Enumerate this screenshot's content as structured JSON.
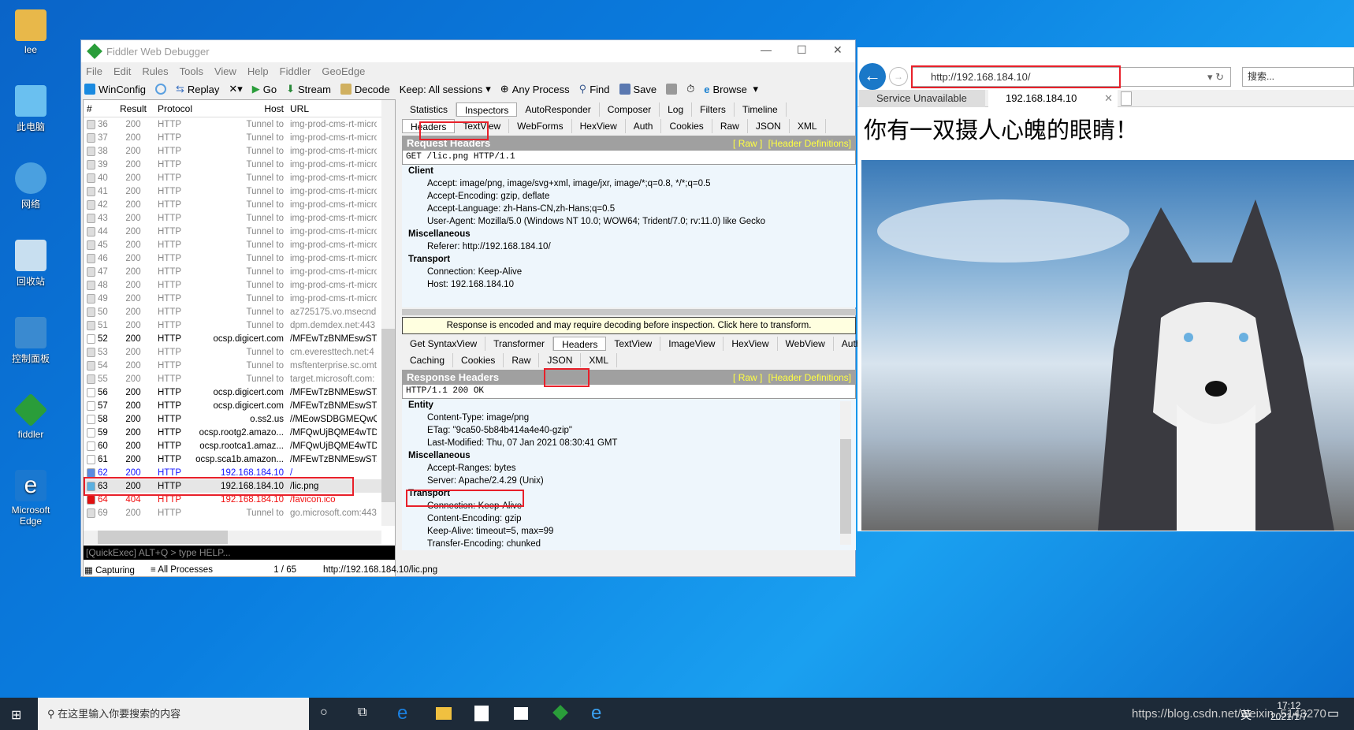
{
  "desktop": {
    "icons": [
      "lee",
      "此电脑",
      "网络",
      "回收站",
      "控制面板",
      "fiddler",
      "Microsoft Edge"
    ]
  },
  "fiddler": {
    "title": "Fiddler Web Debugger",
    "menu": [
      "File",
      "Edit",
      "Rules",
      "Tools",
      "View",
      "Help",
      "Fiddler",
      "GeoEdge"
    ],
    "toolbar": {
      "winconfig": "WinConfig",
      "replay": "Replay",
      "go": "Go",
      "stream": "Stream",
      "decode": "Decode",
      "keep": "Keep: All sessions",
      "process": "Any Process",
      "find": "Find",
      "save": "Save",
      "browse": "Browse"
    },
    "columns": [
      "#",
      "Result",
      "Protocol",
      "Host",
      "URL"
    ],
    "rows": [
      [
        "36",
        "200",
        "HTTP",
        "Tunnel to",
        "img-prod-cms-rt-micro",
        "lock",
        "tunnel"
      ],
      [
        "37",
        "200",
        "HTTP",
        "Tunnel to",
        "img-prod-cms-rt-micro",
        "lock",
        "tunnel"
      ],
      [
        "38",
        "200",
        "HTTP",
        "Tunnel to",
        "img-prod-cms-rt-micro",
        "lock",
        "tunnel"
      ],
      [
        "39",
        "200",
        "HTTP",
        "Tunnel to",
        "img-prod-cms-rt-micro",
        "lock",
        "tunnel"
      ],
      [
        "40",
        "200",
        "HTTP",
        "Tunnel to",
        "img-prod-cms-rt-micro",
        "lock",
        "tunnel"
      ],
      [
        "41",
        "200",
        "HTTP",
        "Tunnel to",
        "img-prod-cms-rt-micro",
        "lock",
        "tunnel"
      ],
      [
        "42",
        "200",
        "HTTP",
        "Tunnel to",
        "img-prod-cms-rt-micro",
        "lock",
        "tunnel"
      ],
      [
        "43",
        "200",
        "HTTP",
        "Tunnel to",
        "img-prod-cms-rt-micro",
        "lock",
        "tunnel"
      ],
      [
        "44",
        "200",
        "HTTP",
        "Tunnel to",
        "img-prod-cms-rt-micro",
        "lock",
        "tunnel"
      ],
      [
        "45",
        "200",
        "HTTP",
        "Tunnel to",
        "img-prod-cms-rt-micro",
        "lock",
        "tunnel"
      ],
      [
        "46",
        "200",
        "HTTP",
        "Tunnel to",
        "img-prod-cms-rt-micro",
        "lock",
        "tunnel"
      ],
      [
        "47",
        "200",
        "HTTP",
        "Tunnel to",
        "img-prod-cms-rt-micro",
        "lock",
        "tunnel"
      ],
      [
        "48",
        "200",
        "HTTP",
        "Tunnel to",
        "img-prod-cms-rt-micro",
        "lock",
        "tunnel"
      ],
      [
        "49",
        "200",
        "HTTP",
        "Tunnel to",
        "img-prod-cms-rt-micro",
        "lock",
        "tunnel"
      ],
      [
        "50",
        "200",
        "HTTP",
        "Tunnel to",
        "az725175.vo.msecnd.",
        "lock",
        "tunnel"
      ],
      [
        "51",
        "200",
        "HTTP",
        "Tunnel to",
        "dpm.demdex.net:443",
        "lock",
        "tunnel"
      ],
      [
        "52",
        "200",
        "HTTP",
        "ocsp.digicert.com",
        "/MFEwTzBNMEswSTAJ",
        "doc",
        "normal"
      ],
      [
        "53",
        "200",
        "HTTP",
        "Tunnel to",
        "cm.everesttech.net:4",
        "lock",
        "tunnel"
      ],
      [
        "54",
        "200",
        "HTTP",
        "Tunnel to",
        "msftenterprise.sc.omt",
        "lock",
        "tunnel"
      ],
      [
        "55",
        "200",
        "HTTP",
        "Tunnel to",
        "target.microsoft.com:",
        "lock",
        "tunnel"
      ],
      [
        "56",
        "200",
        "HTTP",
        "ocsp.digicert.com",
        "/MFEwTzBNMEswSTAJ",
        "doc",
        "normal"
      ],
      [
        "57",
        "200",
        "HTTP",
        "ocsp.digicert.com",
        "/MFEwTzBNMEswSTAJ",
        "doc",
        "normal"
      ],
      [
        "58",
        "200",
        "HTTP",
        "o.ss2.us",
        "//MEowSDBGMEQwQjA",
        "doc",
        "normal"
      ],
      [
        "59",
        "200",
        "HTTP",
        "ocsp.rootg2.amazo...",
        "/MFQwUjBQME4wTDA",
        "doc",
        "normal"
      ],
      [
        "60",
        "200",
        "HTTP",
        "ocsp.rootca1.amaz...",
        "/MFQwUjBQME4wTDA",
        "doc",
        "normal"
      ],
      [
        "61",
        "200",
        "HTTP",
        "ocsp.sca1b.amazon...",
        "/MFEwTzBNMEswSTAJ",
        "doc",
        "normal"
      ],
      [
        "62",
        "200",
        "HTTP",
        "192.168.184.10",
        "/",
        "html",
        "blue"
      ],
      [
        "63",
        "200",
        "HTTP",
        "192.168.184.10",
        "/lic.png",
        "image",
        "sel"
      ],
      [
        "64",
        "404",
        "HTTP",
        "192.168.184.10",
        "/favicon.ico",
        "warning",
        "red"
      ],
      [
        "69",
        "200",
        "HTTP",
        "Tunnel to",
        "go.microsoft.com:443",
        "lock",
        "tunnel"
      ]
    ],
    "quickexec": "[QuickExec] ALT+Q > type HELP...",
    "status": {
      "capturing": "Capturing",
      "processes": "All Processes",
      "count": "1 / 65",
      "url": "http://192.168.184.10/lic.png"
    },
    "top_tabs": [
      "Statistics",
      "Inspectors",
      "AutoResponder",
      "Composer",
      "Log",
      "Filters",
      "Timeline"
    ],
    "req_tabs": [
      "Headers",
      "TextView",
      "WebForms",
      "HexView",
      "Auth",
      "Cookies",
      "Raw",
      "JSON",
      "XML"
    ],
    "request": {
      "title": "Request Headers",
      "raw": "[ Raw ]",
      "defs": "[Header Definitions]",
      "line": "GET /lic.png HTTP/1.1",
      "groups": [
        {
          "name": "Client",
          "items": [
            "Accept: image/png, image/svg+xml, image/jxr, image/*;q=0.8, */*;q=0.5",
            "Accept-Encoding: gzip, deflate",
            "Accept-Language: zh-Hans-CN,zh-Hans;q=0.5",
            "User-Agent: Mozilla/5.0 (Windows NT 10.0; WOW64; Trident/7.0; rv:11.0) like Gecko"
          ]
        },
        {
          "name": "Miscellaneous",
          "items": [
            "Referer: http://192.168.184.10/"
          ]
        },
        {
          "name": "Transport",
          "items": [
            "Connection: Keep-Alive",
            "Host: 192.168.184.10"
          ]
        }
      ]
    },
    "notice": "Response is encoded and may require decoding before inspection. Click here to transform.",
    "resp_tabs1": [
      "Get SyntaxView",
      "Transformer",
      "Headers",
      "TextView",
      "ImageView",
      "HexView",
      "WebView",
      "Auth"
    ],
    "resp_tabs2": [
      "Caching",
      "Cookies",
      "Raw",
      "JSON",
      "XML"
    ],
    "response": {
      "title": "Response Headers",
      "raw": "[ Raw ]",
      "defs": "[Header Definitions]",
      "line": "HTTP/1.1 200 OK",
      "groups": [
        {
          "name": "Entity",
          "items": [
            "Content-Type: image/png",
            "ETag: \"9ca50-5b84b414a4e40-gzip\"",
            "Last-Modified: Thu, 07 Jan 2021 08:30:41 GMT"
          ]
        },
        {
          "name": "Miscellaneous",
          "items": [
            "Accept-Ranges: bytes",
            "Server: Apache/2.4.29 (Unix)"
          ]
        },
        {
          "name": "Transport",
          "items": [
            "Connection: Keep-Alive",
            "Content-Encoding: gzip",
            "Keep-Alive: timeout=5, max=99",
            "Transfer-Encoding: chunked"
          ]
        }
      ]
    }
  },
  "browser": {
    "address": "http://192.168.184.10/",
    "search_placeholder": "搜索...",
    "tabs": [
      "Service Unavailable",
      "192.168.184.10"
    ],
    "heading": "你有一双摄人心魄的眼睛！"
  },
  "taskbar": {
    "search": "在这里输入你要搜索的内容",
    "time": "17:12",
    "date": "2021/1/7",
    "watermark": "https://blog.csdn.net/weixin_5143270",
    "ime": "英"
  },
  "colors": {
    "highlight": "#e8202a",
    "selected_row": "#e6e6e6",
    "link_yellow": "#ffff40"
  }
}
